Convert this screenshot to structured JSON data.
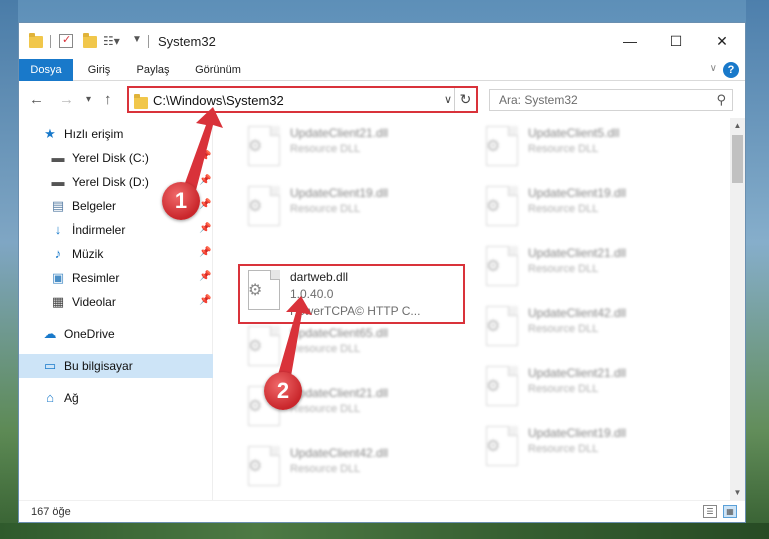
{
  "window": {
    "title": "System32",
    "minimize_label": "—",
    "maximize_label": "☐",
    "close_label": "✕"
  },
  "ribbon": {
    "tabs": [
      {
        "label": "Dosya",
        "active": true
      },
      {
        "label": "Giriş",
        "active": false
      },
      {
        "label": "Paylaş",
        "active": false
      },
      {
        "label": "Görünüm",
        "active": false
      }
    ],
    "help_label": "?"
  },
  "navigation": {
    "back": "←",
    "forward": "→",
    "recent": "▾",
    "up": "↑",
    "address": "C:\\Windows\\System32",
    "search_placeholder": "Ara: System32"
  },
  "sidebar": {
    "items": [
      {
        "label": "Hızlı erişim",
        "icon": "star-icon",
        "pinned": false,
        "selected": false
      },
      {
        "label": "Yerel Disk (C:)",
        "icon": "drive-icon",
        "pinned": true,
        "selected": false
      },
      {
        "label": "Yerel Disk (D:)",
        "icon": "drive-icon",
        "pinned": true,
        "selected": false
      },
      {
        "label": "Belgeler",
        "icon": "documents-icon",
        "pinned": true,
        "selected": false
      },
      {
        "label": "İndirmeler",
        "icon": "download-icon",
        "pinned": true,
        "selected": false
      },
      {
        "label": "Müzik",
        "icon": "music-icon",
        "pinned": true,
        "selected": false
      },
      {
        "label": "Resimler",
        "icon": "pictures-icon",
        "pinned": true,
        "selected": false
      },
      {
        "label": "Videolar",
        "icon": "videos-icon",
        "pinned": true,
        "selected": false
      },
      {
        "label": "OneDrive",
        "icon": "cloud-icon",
        "pinned": false,
        "selected": false
      },
      {
        "label": "Bu bilgisayar",
        "icon": "computer-icon",
        "pinned": false,
        "selected": true
      },
      {
        "label": "Ağ",
        "icon": "network-icon",
        "pinned": false,
        "selected": false
      }
    ]
  },
  "files": {
    "col1": [
      {
        "name": "UpdateClient21.dll",
        "desc": "Resource DLL"
      },
      {
        "name": "UpdateClient19.dll",
        "desc": "Resource DLL"
      },
      {
        "name": "dartweb.dll",
        "version": "1.0.40.0",
        "desc": "PowerTCPA© HTTP C..."
      },
      {
        "name": "UpdateClient65.dll",
        "desc": "Resource DLL"
      },
      {
        "name": "UpdateClient21.dll",
        "desc": "Resource DLL"
      },
      {
        "name": "UpdateClient42.dll",
        "desc": "Resource DLL"
      }
    ],
    "col2": [
      {
        "name": "UpdateClient5.dll",
        "desc": "Resource DLL"
      },
      {
        "name": "UpdateClient19.dll",
        "desc": "Resource DLL"
      },
      {
        "name": "UpdateClient21.dll",
        "desc": "Resource DLL"
      },
      {
        "name": "UpdateClient42.dll",
        "desc": "Resource DLL"
      },
      {
        "name": "UpdateClient21.dll",
        "desc": "Resource DLL"
      },
      {
        "name": "UpdateClient19.dll",
        "desc": "Resource DLL"
      }
    ]
  },
  "status": {
    "item_count": "167 öğe"
  },
  "annotations": {
    "marker1": "1",
    "marker2": "2",
    "color": "#d9323a"
  }
}
